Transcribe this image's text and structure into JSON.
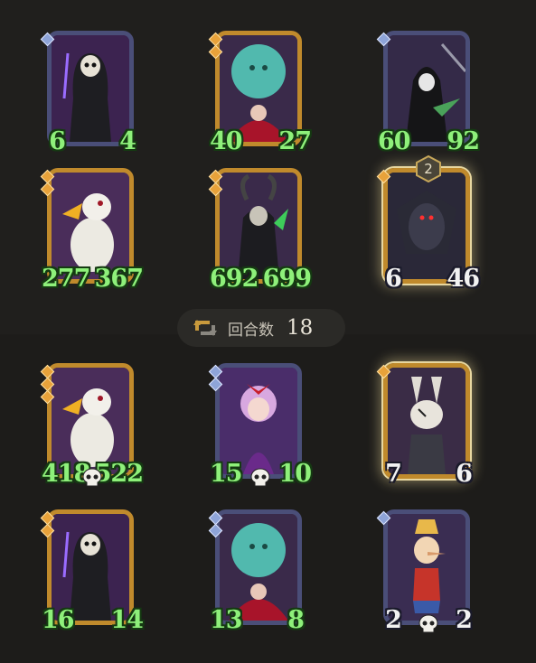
{
  "round": {
    "label": "回合数",
    "value": "18"
  },
  "enemy_board": [
    {
      "name": "hooded-plague-doctor",
      "frame": "blue",
      "gems": [
        "blue"
      ],
      "atk": "6",
      "hp": "4",
      "atk_disc": "purple",
      "hp_disc": "red",
      "text": "green"
    },
    {
      "name": "ghost-hag-cauldron",
      "frame": "gold",
      "gems": [
        "gold",
        "gold"
      ],
      "atk": "40",
      "hp": "27",
      "atk_disc": "none",
      "hp_disc": "none",
      "text": "green"
    },
    {
      "name": "skeleton-reaper",
      "frame": "blue",
      "gems": [
        "blue"
      ],
      "atk": "60",
      "hp": "92",
      "atk_disc": "none",
      "hp_disc": "none",
      "text": "green"
    },
    {
      "name": "white-vulture",
      "frame": "gold",
      "gems": [
        "gold",
        "gold"
      ],
      "atk": "277",
      "hp": "367",
      "atk_disc": "purple",
      "hp_disc": "red",
      "text": "green"
    },
    {
      "name": "horned-lich",
      "frame": "gold",
      "gems": [
        "gold",
        "gold"
      ],
      "atk": "692",
      "hp": "699",
      "atk_disc": "none",
      "hp_disc": "none",
      "text": "green"
    },
    {
      "name": "dark-winged-knight",
      "frame": "gold",
      "gems": [
        "gold"
      ],
      "atk": "6",
      "hp": "46",
      "atk_disc": "red",
      "hp_disc": "red",
      "text": "white",
      "badge": "2",
      "selected": true
    }
  ],
  "player_board": [
    {
      "name": "white-vulture",
      "frame": "gold",
      "gems": [
        "gold",
        "gold",
        "gold"
      ],
      "atk": "418",
      "hp": "522",
      "atk_disc": "purple",
      "hp_disc": "red",
      "text": "green",
      "skull": true
    },
    {
      "name": "sleeping-doll-girl",
      "frame": "blue",
      "gems": [
        "blue",
        "blue"
      ],
      "atk": "15",
      "hp": "10",
      "atk_disc": "blue",
      "hp_disc": "none",
      "text": "green",
      "skull": true
    },
    {
      "name": "patchwork-rabbit",
      "frame": "gold",
      "gems": [
        "gold"
      ],
      "atk": "7",
      "hp": "6",
      "atk_disc": "blue",
      "hp_disc": "red",
      "text": "white",
      "selected": true
    },
    {
      "name": "hooded-plague-doctor",
      "frame": "gold",
      "gems": [
        "gold",
        "gold"
      ],
      "atk": "16",
      "hp": "14",
      "atk_disc": "none",
      "hp_disc": "red",
      "text": "green"
    },
    {
      "name": "ghost-hag-cauldron",
      "frame": "blue",
      "gems": [
        "blue",
        "blue"
      ],
      "atk": "13",
      "hp": "8",
      "atk_disc": "none",
      "hp_disc": "red",
      "text": "green"
    },
    {
      "name": "pinocchio-puppet",
      "frame": "blue",
      "gems": [
        "blue"
      ],
      "atk": "2",
      "hp": "2",
      "atk_disc": "blue",
      "hp_disc": "red",
      "text": "white",
      "skull": true
    }
  ],
  "icons": {
    "round": "cycle-arrows-icon",
    "death": "skull-icon"
  }
}
